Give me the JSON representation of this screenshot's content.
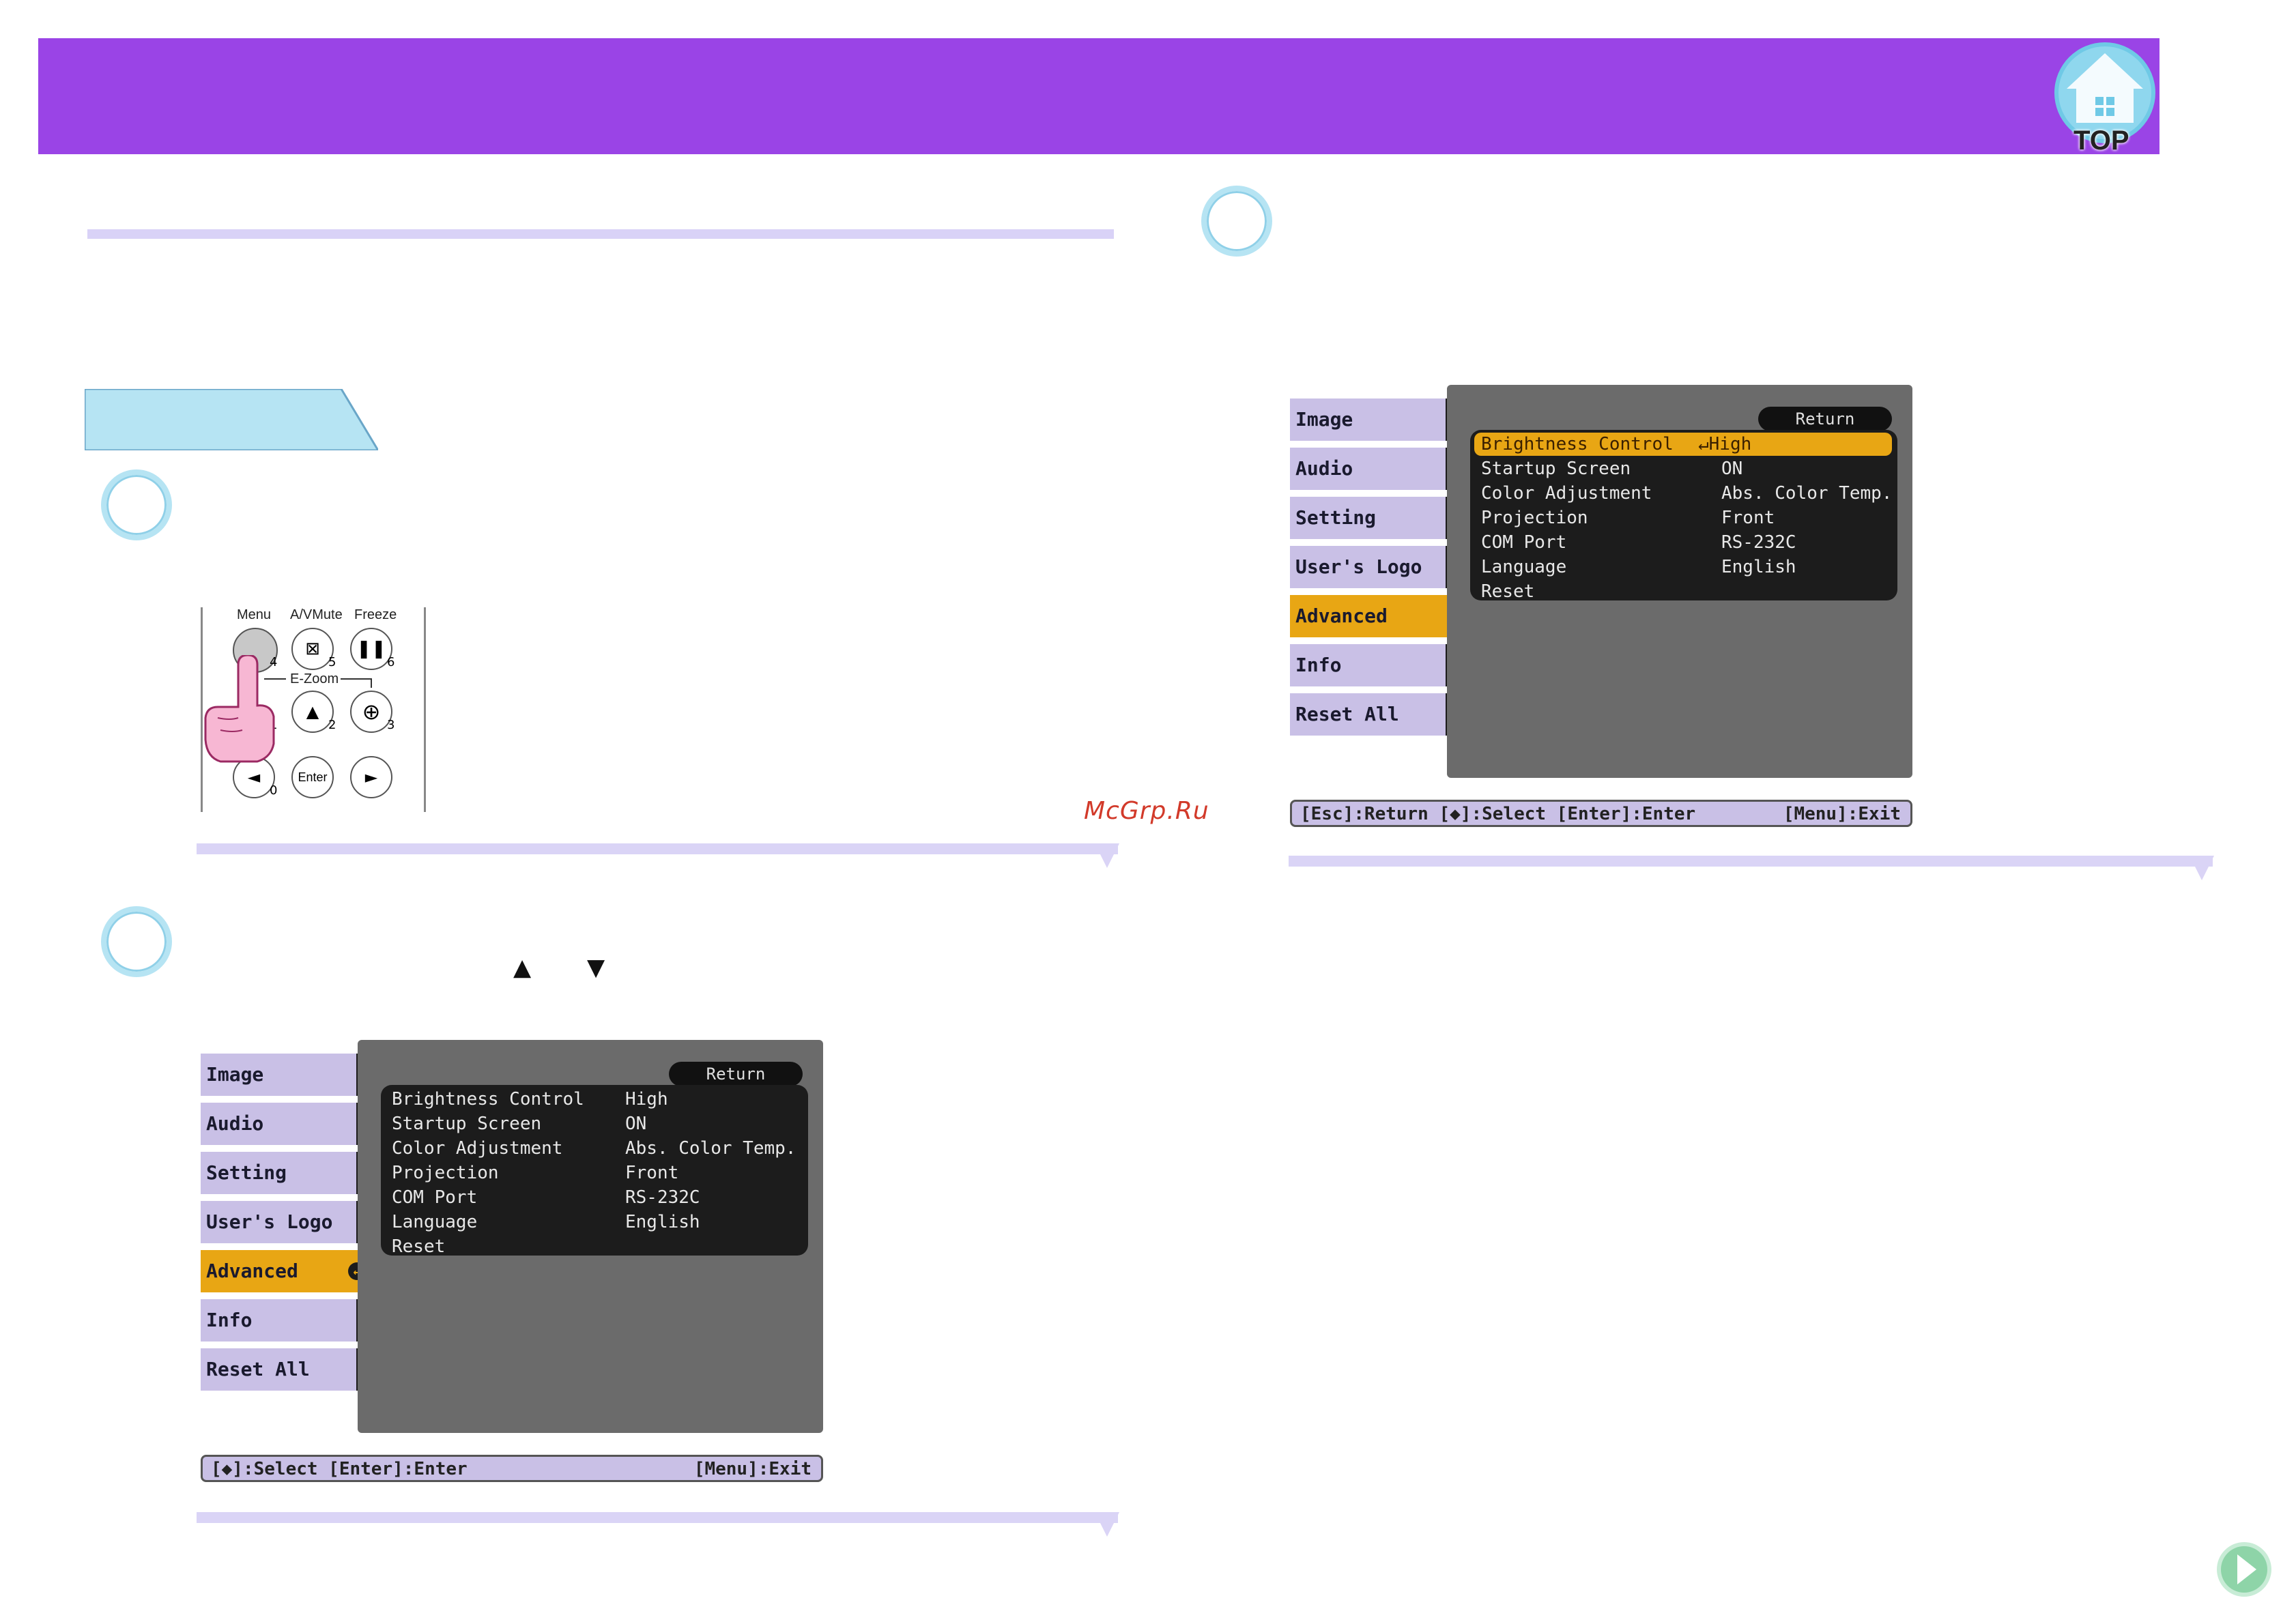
{
  "watermark": "McGrp.Ru",
  "top_button": {
    "label": "TOP",
    "icon": "house-icon"
  },
  "next_button": {
    "icon": "next-arrow-icon"
  },
  "remote": {
    "labels": {
      "menu": "Menu",
      "avmute": "A/VMute",
      "freeze": "Freeze",
      "ezoom": "E-Zoom",
      "enter": "Enter"
    },
    "numbers": [
      "4",
      "5",
      "6",
      "1",
      "2",
      "3",
      "0"
    ]
  },
  "arrows": {
    "up": "▲",
    "down": "▼"
  },
  "menu1": {
    "tabs": [
      "Image",
      "Audio",
      "Setting",
      "User's Logo",
      "Advanced",
      "Info",
      "Reset All"
    ],
    "active_tab": "Advanced",
    "return_label": "Return",
    "rows": [
      {
        "label": "Brightness Control",
        "value": "High"
      },
      {
        "label": "Startup Screen",
        "value": "ON"
      },
      {
        "label": "Color Adjustment",
        "value": "Abs. Color Temp."
      },
      {
        "label": "Projection",
        "value": "Front"
      },
      {
        "label": "COM Port",
        "value": "RS-232C"
      },
      {
        "label": "Language",
        "value": "English"
      },
      {
        "label": "Reset",
        "value": ""
      }
    ],
    "status_left": "[◆]:Select [Enter]:Enter",
    "status_right": "[Menu]:Exit"
  },
  "menu2": {
    "tabs": [
      "Image",
      "Audio",
      "Setting",
      "User's Logo",
      "Advanced",
      "Info",
      "Reset All"
    ],
    "active_tab": "Advanced",
    "return_label": "Return",
    "rows": [
      {
        "label": "Brightness Control",
        "value": "High"
      },
      {
        "label": "Startup Screen",
        "value": "ON"
      },
      {
        "label": "Color Adjustment",
        "value": "Abs. Color Temp."
      },
      {
        "label": "Projection",
        "value": "Front"
      },
      {
        "label": "COM Port",
        "value": "RS-232C"
      },
      {
        "label": "Language",
        "value": "English"
      },
      {
        "label": "Reset",
        "value": ""
      }
    ],
    "status_left": "[Esc]:Return [◆]:Select [Enter]:Enter",
    "status_right": "[Menu]:Exit"
  },
  "colors": {
    "header": "#9a44e6",
    "accent": "#e8a614",
    "tab": "#c9c0e6",
    "rule": "#d9d2f7",
    "circle_border": "#b6e4f3",
    "tab_shape": "#b6e4f3"
  }
}
